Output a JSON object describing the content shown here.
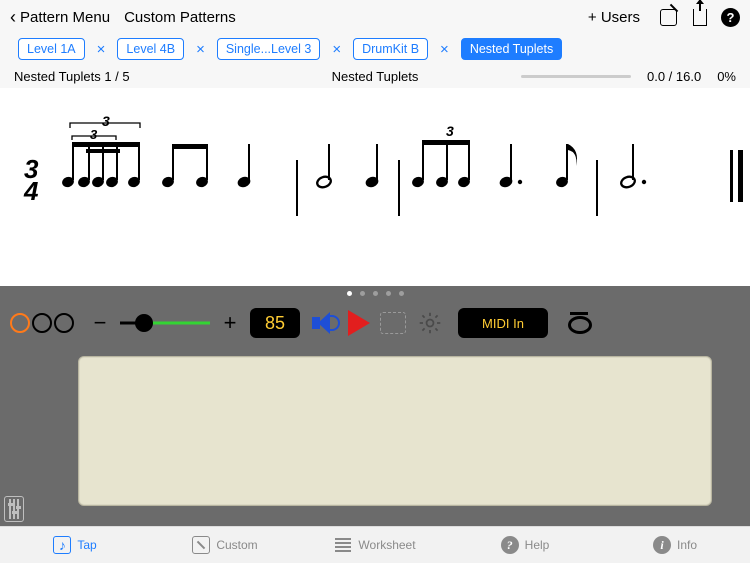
{
  "nav": {
    "back_label": "Pattern Menu",
    "title": "Custom Patterns",
    "plus_users": "+ Users",
    "help_glyph": "?"
  },
  "chips": [
    {
      "label": "Level 1A",
      "active": false,
      "closable": true
    },
    {
      "label": "Level 4B",
      "active": false,
      "closable": true
    },
    {
      "label": "Single...Level 3",
      "active": false,
      "closable": true
    },
    {
      "label": "DrumKit B",
      "active": false,
      "closable": true
    },
    {
      "label": "Nested Tuplets",
      "active": true,
      "closable": false
    }
  ],
  "status": {
    "left": "Nested Tuplets 1 / 5",
    "center": "Nested Tuplets",
    "score": "0.0 / 16.0",
    "percent": "0%"
  },
  "notation": {
    "time_sig_top": "3",
    "time_sig_bottom": "4",
    "tuplet_marks": [
      "3",
      "3",
      "3"
    ]
  },
  "pager": {
    "count": 5,
    "active": 0
  },
  "controls": {
    "minus": "−",
    "plus": "+",
    "tempo": "85",
    "midi": "MIDI In"
  },
  "tabs": {
    "tap": "Tap",
    "custom": "Custom",
    "worksheet": "Worksheet",
    "help": "Help",
    "info": "Info",
    "help_glyph": "?",
    "info_glyph": "i",
    "tap_glyph": "♪"
  }
}
